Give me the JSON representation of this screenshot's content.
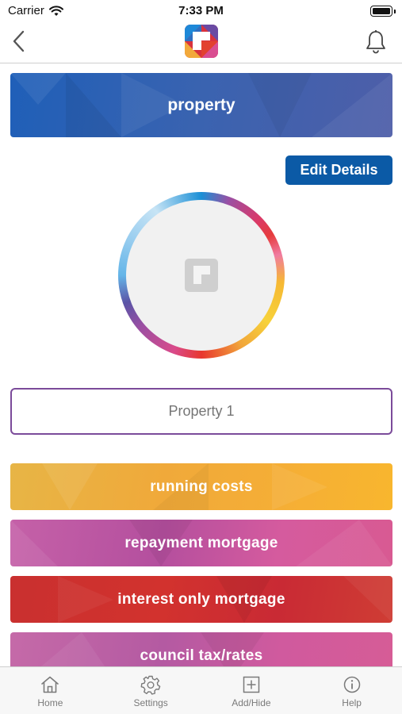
{
  "status_bar": {
    "carrier": "Carrier",
    "time": "7:33 PM"
  },
  "nav": {
    "back_icon": "chevron-left-icon",
    "logo": "app-logo",
    "bell_icon": "bell-icon"
  },
  "header": {
    "title": "property"
  },
  "actions": {
    "edit_label": "Edit Details"
  },
  "avatar": {
    "icon": "placeholder-logo-icon"
  },
  "name_field": {
    "placeholder": "Property 1"
  },
  "categories": [
    {
      "label": "running costs",
      "color": "#f0a93a"
    },
    {
      "label": "repayment mortgage",
      "color": "#c7579e"
    },
    {
      "label": "interest only mortgage",
      "color": "#cd2f31"
    },
    {
      "label": "council tax/rates",
      "color": "#c862a4"
    }
  ],
  "tabs": [
    {
      "label": "Home",
      "icon": "home-icon"
    },
    {
      "label": "Settings",
      "icon": "gear-icon"
    },
    {
      "label": "Add/Hide",
      "icon": "plus-square-icon"
    },
    {
      "label": "Help",
      "icon": "info-icon"
    }
  ],
  "colors": {
    "primary_blue": "#0b5aa6",
    "field_border": "#7b4b9a"
  }
}
